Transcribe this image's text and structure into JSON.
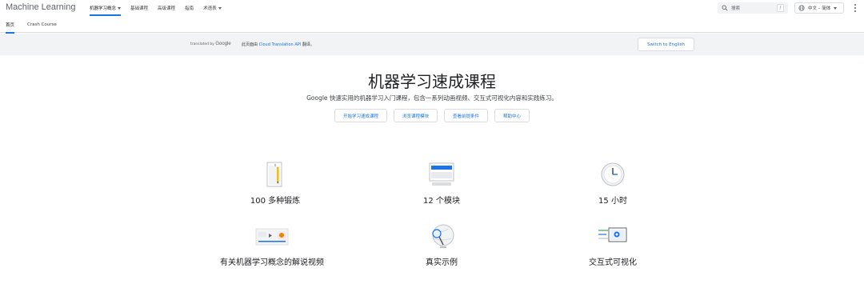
{
  "header": {
    "brand": "Machine Learning",
    "nav": [
      {
        "label": "机器学习概念",
        "active": true,
        "dropdown": true
      },
      {
        "label": "基础课程",
        "active": false,
        "dropdown": false
      },
      {
        "label": "高级课程",
        "active": false,
        "dropdown": false
      },
      {
        "label": "指南",
        "active": false,
        "dropdown": false
      },
      {
        "label": "术语表",
        "active": false,
        "dropdown": true
      }
    ],
    "search_placeholder": "搜索",
    "search_shortcut": "/",
    "language": "中文 – 简体"
  },
  "subtabs": [
    {
      "label": "首页",
      "active": true
    },
    {
      "label": "Crash Course",
      "active": false
    }
  ],
  "banner": {
    "translated_by": "translated by",
    "translated_brand": "Google",
    "note_prefix": "此页面由",
    "note_link": "Cloud Translation API",
    "note_suffix": "翻译。",
    "switch_label": "Switch to English"
  },
  "hero": {
    "title": "机器学习速成课程",
    "subtitle": "Google 快速实用的机器学习入门课程，包含一系列动画视频、交互式可视化内容和实践练习。",
    "buttons": [
      "开始学习速成课程",
      "浏览课程模块",
      "查看前提条件",
      "帮助中心"
    ]
  },
  "features": [
    {
      "label": "100 多种锻炼",
      "icon": "exercise-sheet-icon"
    },
    {
      "label": "12 个模块",
      "icon": "modules-screen-icon"
    },
    {
      "label": "15 小时",
      "icon": "clock-icon"
    },
    {
      "label": "有关机器学习概念的解说视频",
      "icon": "video-player-icon"
    },
    {
      "label": "真实示例",
      "icon": "magnifier-globe-icon"
    },
    {
      "label": "交互式可视化",
      "icon": "interactive-visualization-icon"
    }
  ],
  "colors": {
    "accent": "#1a73e8",
    "banner_bg": "#f1f3f4",
    "border": "#dadce0"
  }
}
